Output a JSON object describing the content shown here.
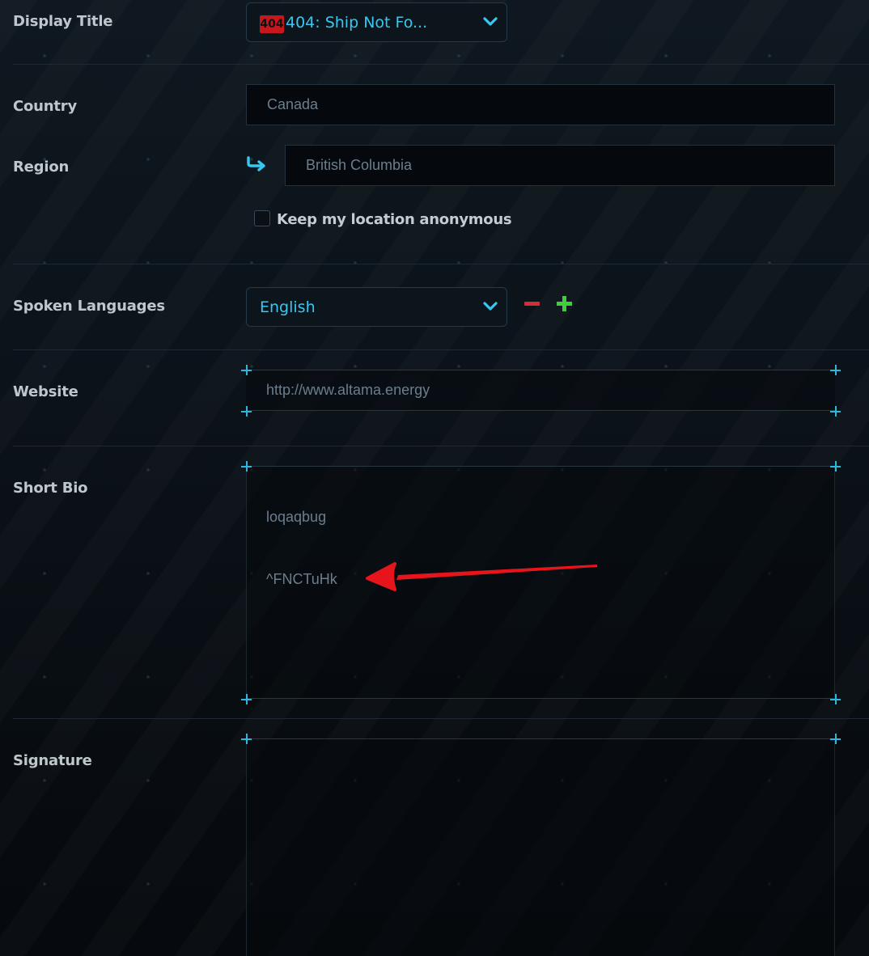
{
  "fields": {
    "display_title": {
      "label": "Display Title",
      "badge": "404",
      "value": "404: Ship Not Fo..."
    },
    "country": {
      "label": "Country",
      "value": "Canada"
    },
    "region": {
      "label": "Region",
      "value": "British Columbia"
    },
    "anonymous": {
      "label": "Keep my location anonymous",
      "checked": false
    },
    "spoken_languages": {
      "label": "Spoken Languages",
      "value": "English"
    },
    "website": {
      "label": "Website",
      "value": "http://www.altama.energy"
    },
    "short_bio": {
      "label": "Short Bio",
      "lines": [
        "loqaqbug",
        "^FNCTuHk"
      ]
    },
    "signature": {
      "label": "Signature",
      "value": ""
    }
  },
  "colors": {
    "accent": "#37c8f2",
    "remove": "#d12d3a",
    "add": "#3fcf3a",
    "annotation_arrow": "#e8141c",
    "badge": "#c8161d"
  },
  "icons": [
    "chevron-down-icon",
    "return-arrow-icon",
    "minus-icon",
    "plus-icon",
    "annotation-arrow"
  ]
}
